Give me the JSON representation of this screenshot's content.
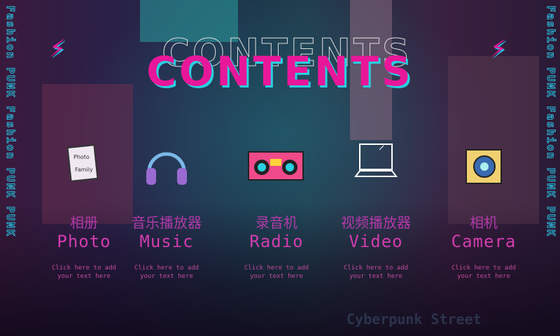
{
  "side_text": "Fashion PUNK Fashion PUNK PUNK",
  "title": "CONTENTS",
  "items": [
    {
      "cn": "相册",
      "en": "Photo",
      "hint1": "Click here to add",
      "hint2": "your text here",
      "icon": "photo-album-icon",
      "icon_text1": "Photo",
      "icon_text2": "Family"
    },
    {
      "cn": "音乐播放器",
      "en": "Music",
      "hint1": "Click here to add",
      "hint2": "your text here",
      "icon": "headphones-icon"
    },
    {
      "cn": "录音机",
      "en": "Radio",
      "hint1": "Click here to add",
      "hint2": "your text here",
      "icon": "boombox-icon"
    },
    {
      "cn": "视频播放器",
      "en": "Video",
      "hint1": "Click here to add",
      "hint2": "your text here",
      "icon": "laptop-icon"
    },
    {
      "cn": "相机",
      "en": "Camera",
      "hint1": "Click here to add",
      "hint2": "your text here",
      "icon": "camera-icon"
    }
  ],
  "footer": "Cyberpunk Street",
  "colors": {
    "accent": "#e8179a",
    "cyan": "#29d0e0"
  }
}
